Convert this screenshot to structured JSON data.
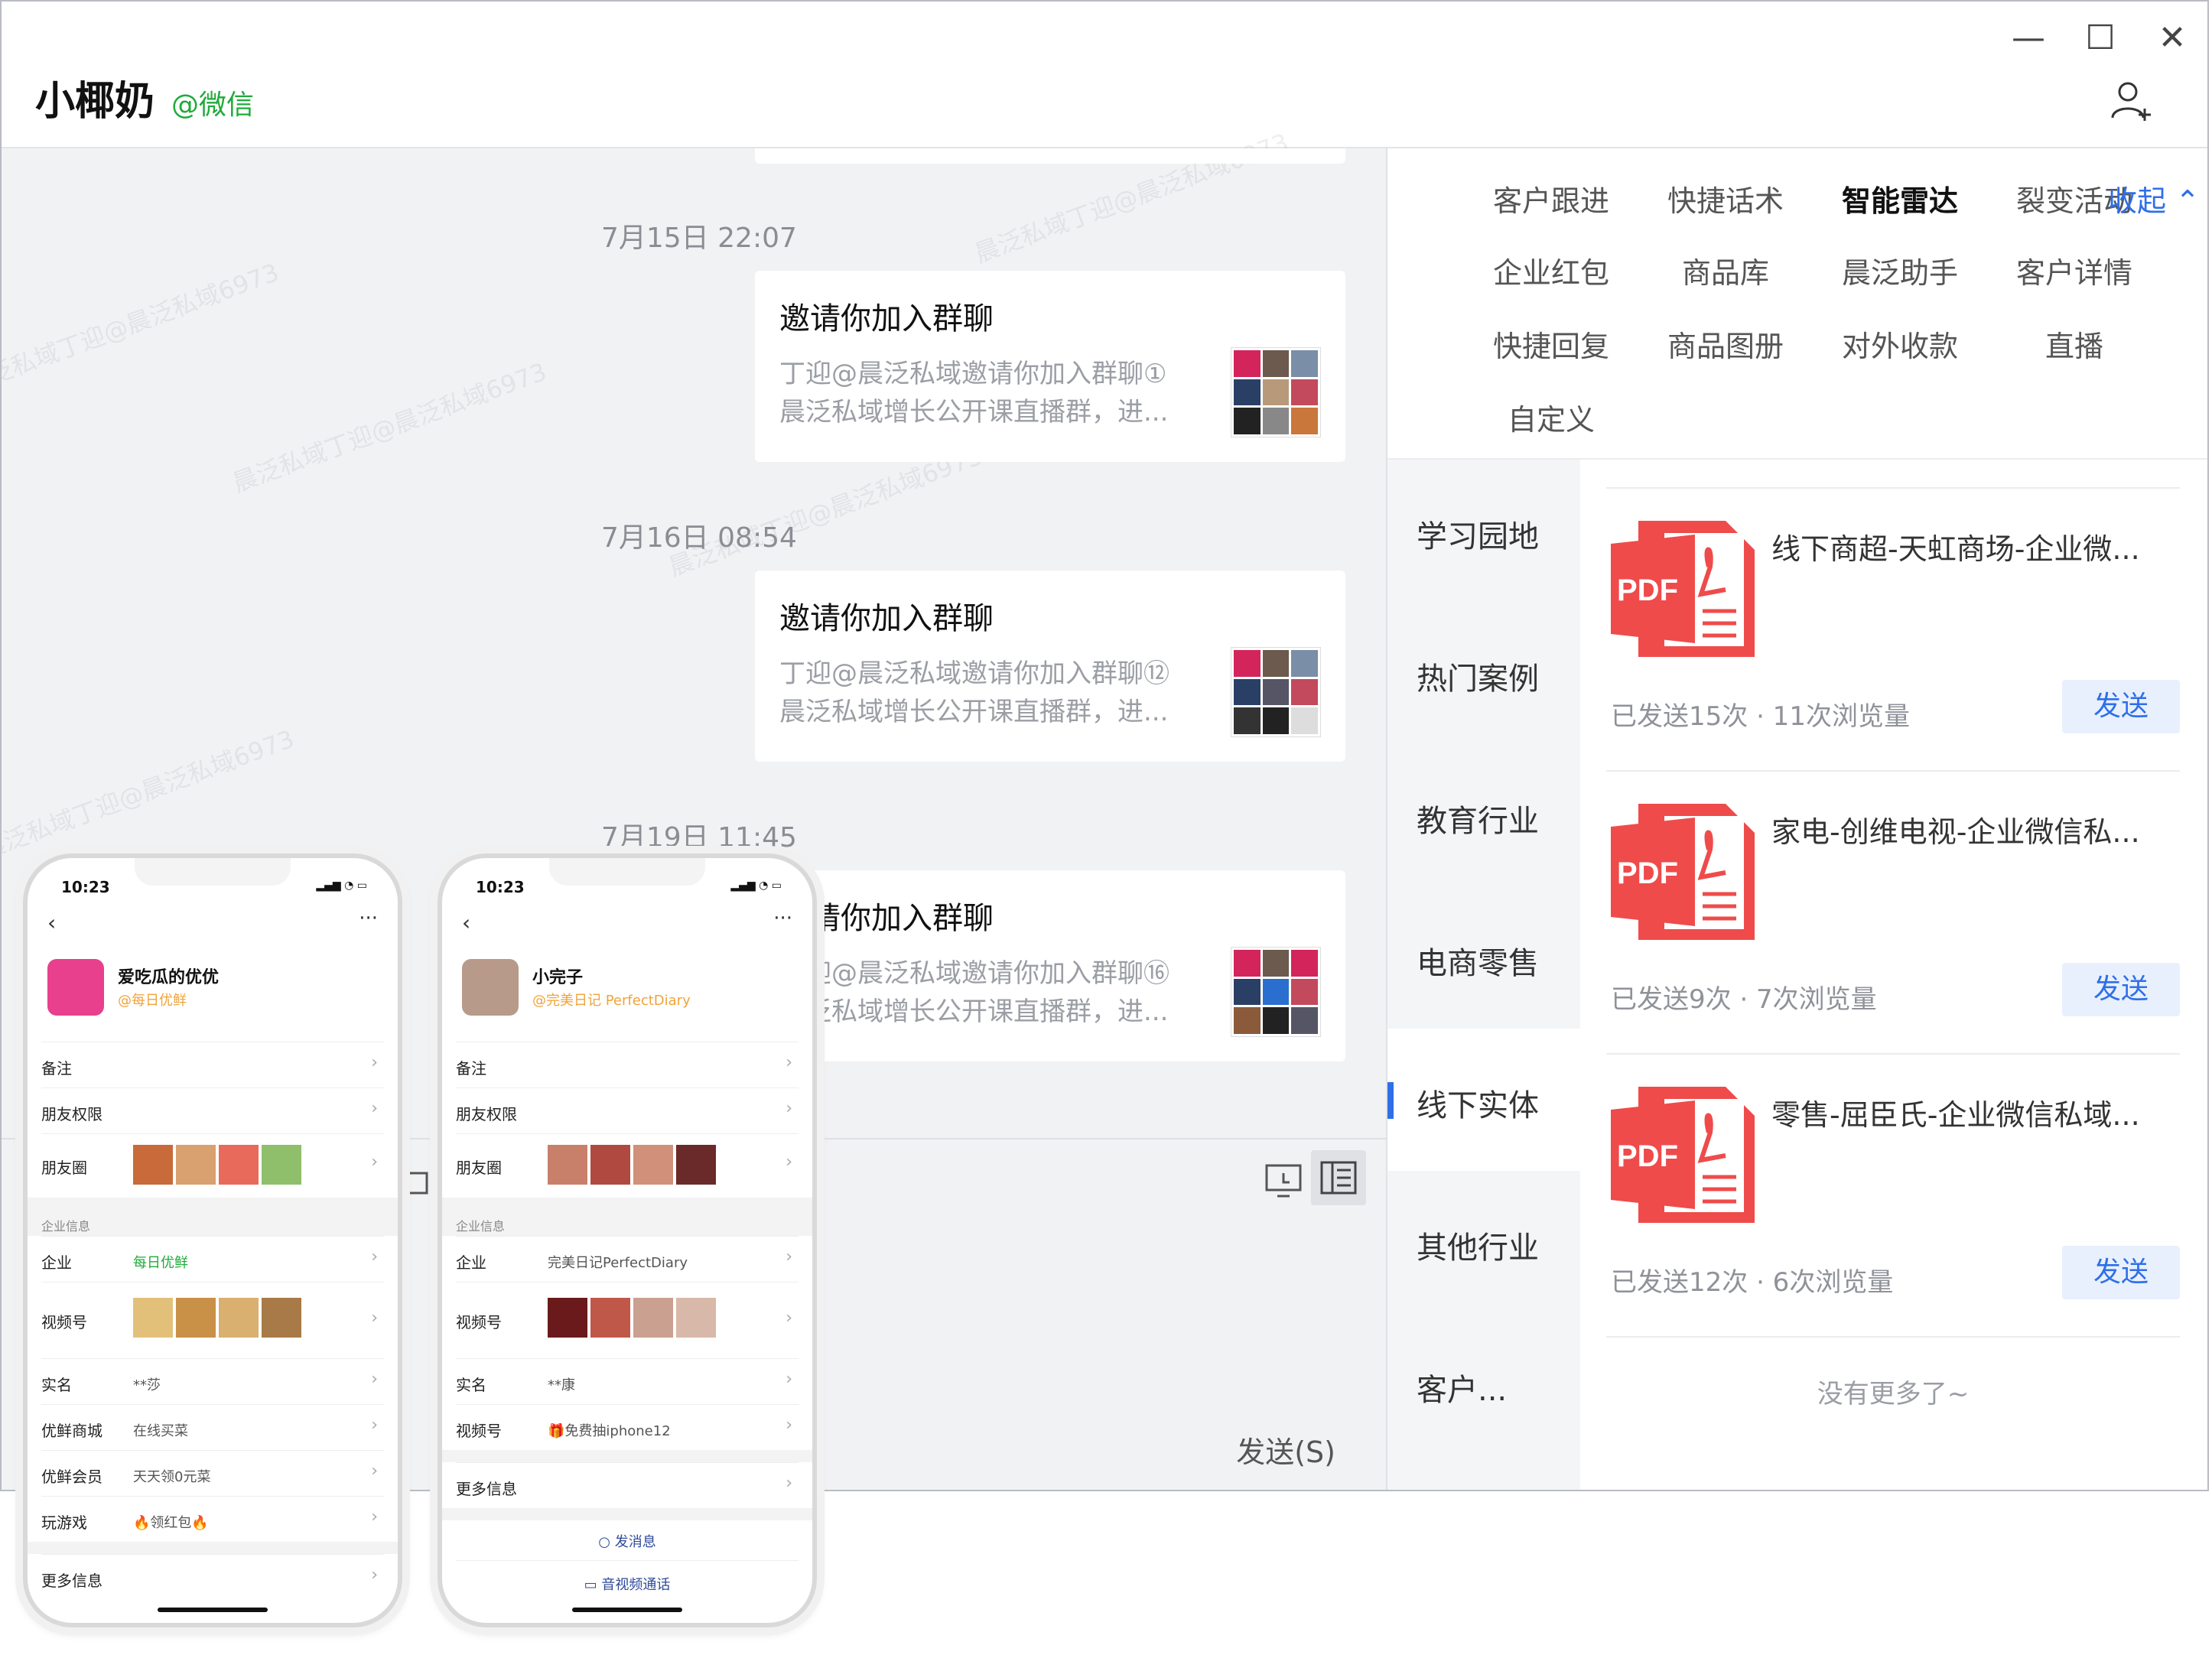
{
  "window": {
    "title_name": "小椰奶",
    "title_tag": "@微信",
    "controls": {
      "minimize": "—",
      "maximize": "☐",
      "close": "✕"
    }
  },
  "chat": {
    "watermark": "晨泛私域丁迎@晨泛私域6973",
    "messages": [
      {
        "time": "7月15日 22:07",
        "title": "邀请你加入群聊",
        "desc_line1": "丁迎@晨泛私域邀请你加入群聊①",
        "desc_line2": "晨泛私域增长公开课直播群，进..."
      },
      {
        "time": "7月16日 08:54",
        "title": "邀请你加入群聊",
        "desc_line1": "丁迎@晨泛私域邀请你加入群聊⑫",
        "desc_line2": "晨泛私域增长公开课直播群，进..."
      },
      {
        "time": "7月19日 11:45",
        "title": "邀请你加入群聊",
        "desc_line1": "丁迎@晨泛私域邀请你加入群聊⑯",
        "desc_line2": "晨泛私域增长公开课直播群，进..."
      }
    ],
    "send_label": "发送(S)"
  },
  "right_panel": {
    "tabs": [
      {
        "label": "客户跟进",
        "active": false
      },
      {
        "label": "快捷话术",
        "active": false
      },
      {
        "label": "智能雷达",
        "active": true
      },
      {
        "label": "裂变活动",
        "active": false
      },
      {
        "label": "企业红包",
        "active": false
      },
      {
        "label": "商品库",
        "active": false
      },
      {
        "label": "晨泛助手",
        "active": false
      },
      {
        "label": "客户详情",
        "active": false
      },
      {
        "label": "快捷回复",
        "active": false
      },
      {
        "label": "商品图册",
        "active": false
      },
      {
        "label": "对外收款",
        "active": false
      },
      {
        "label": "直播",
        "active": false
      },
      {
        "label": "自定义",
        "active": false
      }
    ],
    "collapse_label": "收起 ⌃",
    "categories": [
      {
        "label": "学习园地",
        "active": false
      },
      {
        "label": "热门案例",
        "active": false
      },
      {
        "label": "教育行业",
        "active": false
      },
      {
        "label": "电商零售",
        "active": false
      },
      {
        "label": "线下实体",
        "active": true
      },
      {
        "label": "其他行业",
        "active": false
      },
      {
        "label": "客户...",
        "active": false
      }
    ],
    "documents": [
      {
        "icon_text": "PDF",
        "title": "线下商超-天虹商场-企业微...",
        "stats": "已发送15次 · 11次浏览量",
        "send": "发送"
      },
      {
        "icon_text": "PDF",
        "title": "家电-创维电视-企业微信私...",
        "stats": "已发送9次 · 7次浏览量",
        "send": "发送"
      },
      {
        "icon_text": "PDF",
        "title": "零售-屈臣氏-企业微信私域...",
        "stats": "已发送12次 · 6次浏览量",
        "send": "发送"
      }
    ],
    "no_more": "没有更多了~"
  },
  "phone1": {
    "time": "10:23",
    "name": "爱吃瓜的优优",
    "sub": "@每日优鲜",
    "rows_top": [
      {
        "label": "备注",
        "value": ""
      },
      {
        "label": "朋友权限",
        "value": ""
      },
      {
        "label": "朋友圈",
        "value": ""
      }
    ],
    "section": "企业信息",
    "rows_company": [
      {
        "label": "企业",
        "value": "每日优鲜"
      },
      {
        "label": "视频号",
        "value": ""
      },
      {
        "label": "实名",
        "value": "**莎"
      },
      {
        "label": "优鲜商城",
        "value": "在线买菜"
      },
      {
        "label": "优鲜会员",
        "value": "天天领0元菜"
      },
      {
        "label": "玩游戏",
        "value": "🔥领红包🔥"
      }
    ],
    "more": "更多信息"
  },
  "phone2": {
    "time": "10:23",
    "name": "小完子",
    "sub": "@完美日记 PerfectDiary",
    "rows_top": [
      {
        "label": "备注",
        "value": ""
      },
      {
        "label": "朋友权限",
        "value": ""
      },
      {
        "label": "朋友圈",
        "value": ""
      }
    ],
    "section": "企业信息",
    "rows_company": [
      {
        "label": "企业",
        "value": "完美日记PerfectDiary"
      },
      {
        "label": "视频号",
        "value": ""
      },
      {
        "label": "实名",
        "value": "**康"
      },
      {
        "label": "视频号",
        "value": "🎁免费抽iphone12"
      }
    ],
    "more": "更多信息",
    "send_message": "发消息",
    "video_call": "音视频通话"
  },
  "colors": {
    "accent": "#2f6fe8",
    "wechat_green": "#1fab3a",
    "pdf_red": "#ef4b4b"
  },
  "icons": [
    "minimize-icon",
    "maximize-icon",
    "close-icon",
    "add-contact-icon",
    "folder-icon",
    "screen-share-icon",
    "sidebar-icon",
    "pdf-icon",
    "chevron-right-icon",
    "back-icon",
    "more-icon"
  ]
}
